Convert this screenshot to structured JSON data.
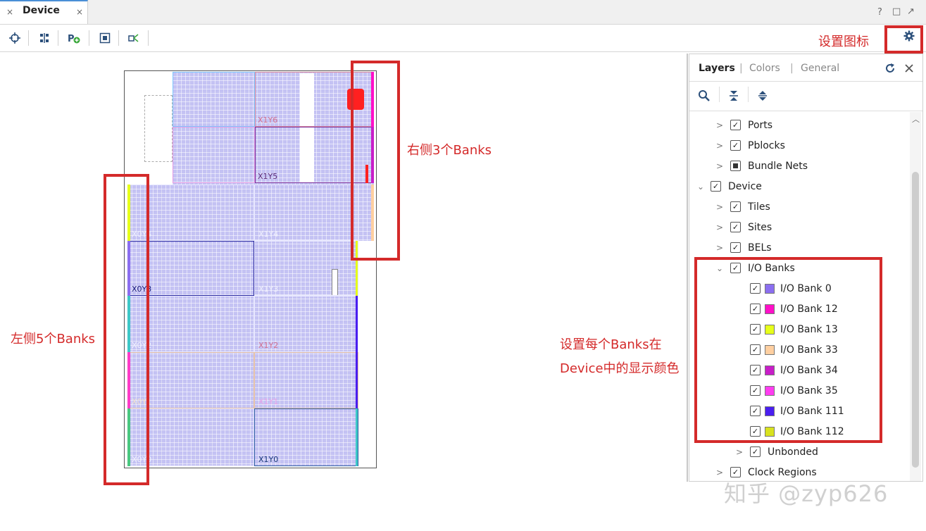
{
  "window": {
    "tab_title": "Device",
    "tab_close": "×",
    "buttons": [
      "?",
      "□",
      "↗"
    ]
  },
  "toolbar": {
    "icons": [
      "crosshair-icon",
      "route-icon",
      "add-pblock-icon",
      "fit-icon",
      "schematic-icon"
    ],
    "settings_icon": "gear-icon"
  },
  "device": {
    "regions": [
      "X1Y6",
      "X1Y5",
      "X0Y4",
      "X1Y4",
      "X0Y3",
      "X1Y3",
      "X0Y2",
      "X1Y2",
      "X0Y1",
      "X1Y1",
      "X0Y0",
      "X1Y0"
    ]
  },
  "panel": {
    "tabs": [
      "Layers",
      "Colors",
      "General"
    ],
    "separator": "|",
    "tree": {
      "ports": "Ports",
      "pblocks": "Pblocks",
      "bundle_nets": "Bundle Nets",
      "device": "Device",
      "tiles": "Tiles",
      "sites": "Sites",
      "bels": "BELs",
      "io_banks": "I/O Banks",
      "unbonded": "Unbonded",
      "clock_regions": "Clock Regions"
    },
    "banks": [
      {
        "label": "I/O Bank 0",
        "color": "#8b6ef0"
      },
      {
        "label": "I/O Bank 12",
        "color": "#ff10c8"
      },
      {
        "label": "I/O Bank 13",
        "color": "#e6ff1a"
      },
      {
        "label": "I/O Bank 33",
        "color": "#ffcfa0"
      },
      {
        "label": "I/O Bank 34",
        "color": "#c81ec8"
      },
      {
        "label": "I/O Bank 35",
        "color": "#ff3cf0"
      },
      {
        "label": "I/O Bank 111",
        "color": "#4a1ef0"
      },
      {
        "label": "I/O Bank 112",
        "color": "#d8e21e"
      }
    ]
  },
  "annotations": {
    "settings_icon": "设置图标",
    "right_banks": "右侧3个Banks",
    "left_banks": "左侧5个Banks",
    "bank_colors_line1": "设置每个Banks在",
    "bank_colors_line2": "Device中的显示颜色"
  },
  "watermark": "知乎 @zyp626",
  "colors": {
    "annotation_red": "#d42a2a",
    "device_fill": "#c4c2f3"
  }
}
